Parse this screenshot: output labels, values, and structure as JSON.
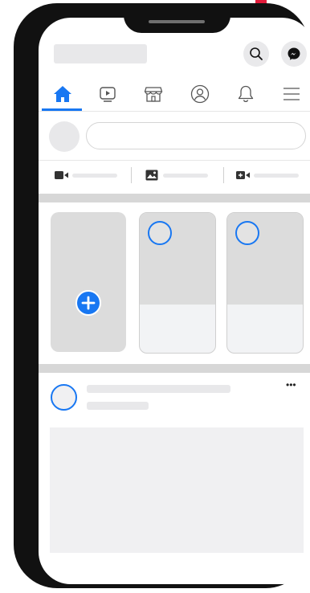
{
  "header": {
    "icons": [
      "search-icon",
      "messenger-icon"
    ]
  },
  "tabs": [
    {
      "icon": "home-icon",
      "active": true
    },
    {
      "icon": "watch-icon",
      "active": false
    },
    {
      "icon": "marketplace-icon",
      "active": false
    },
    {
      "icon": "profile-icon",
      "active": false
    },
    {
      "icon": "notifications-icon",
      "active": false
    },
    {
      "icon": "menu-icon",
      "active": false
    }
  ],
  "composer": {
    "actions": [
      "live-video-icon",
      "photo-icon",
      "room-icon"
    ]
  },
  "post": {
    "more": "•••"
  },
  "colors": {
    "accent": "#1877f2",
    "placeholder": "#e8e8ea",
    "separator": "#d7d7d7"
  }
}
